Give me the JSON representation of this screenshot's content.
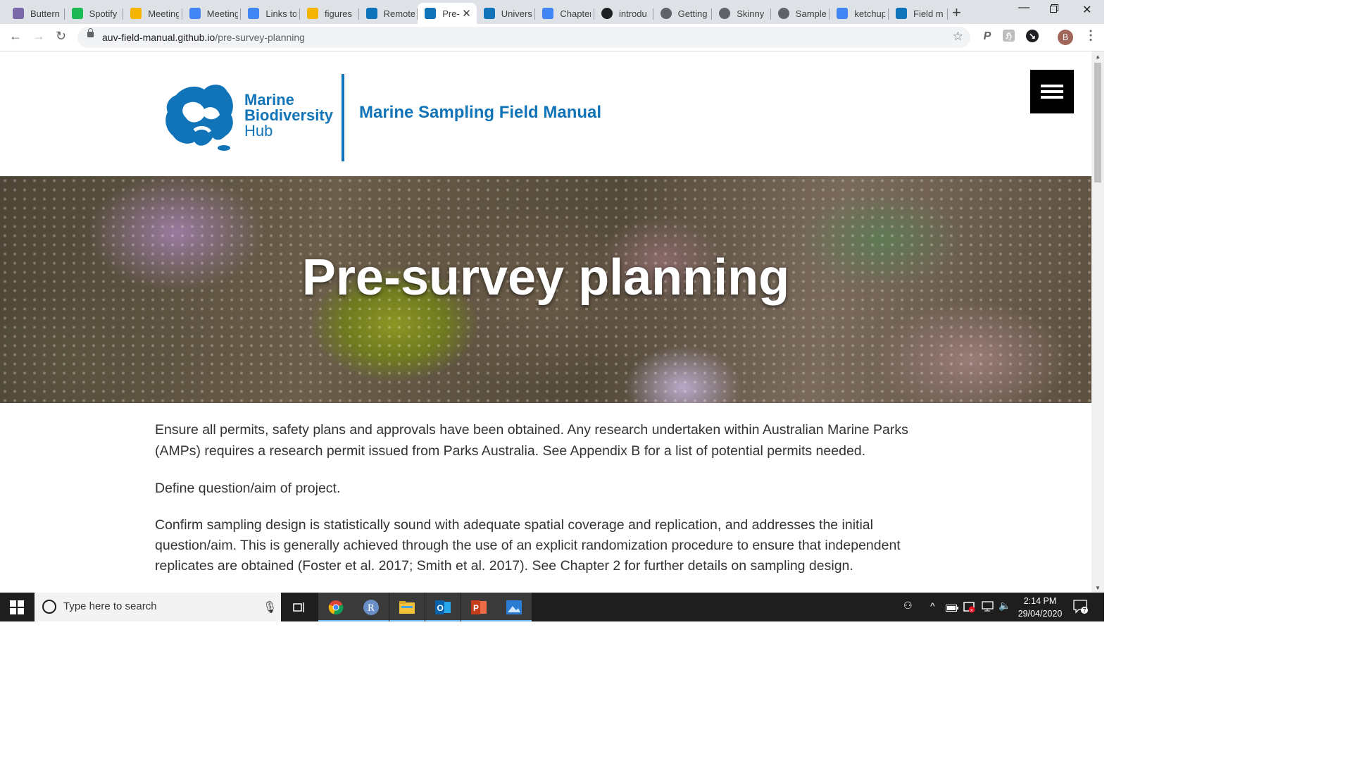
{
  "browser": {
    "tabs": [
      {
        "label": "Buttern",
        "icon": "mr-icon",
        "color": "#7b68a8"
      },
      {
        "label": "Spotify",
        "icon": "spotify-icon",
        "color": "#1db954"
      },
      {
        "label": "Meeting",
        "icon": "drive-icon",
        "color": "#f4b400"
      },
      {
        "label": "Meeting",
        "icon": "docs-icon",
        "color": "#4285f4"
      },
      {
        "label": "Links to",
        "icon": "docs-icon",
        "color": "#4285f4"
      },
      {
        "label": "figures",
        "icon": "drive-icon",
        "color": "#f4b400"
      },
      {
        "label": "Remote",
        "icon": "hub-icon",
        "color": "#1274b8"
      },
      {
        "label": "Pre-",
        "icon": "hub-icon",
        "color": "#1274b8"
      },
      {
        "label": "Univers",
        "icon": "hub-icon",
        "color": "#1274b8"
      },
      {
        "label": "Chapter",
        "icon": "docs-icon",
        "color": "#4285f4"
      },
      {
        "label": "introdu",
        "icon": "github-icon",
        "color": "#202124"
      },
      {
        "label": "Getting",
        "icon": "globe-icon",
        "color": "#5f6368"
      },
      {
        "label": "Skinny",
        "icon": "globe-icon",
        "color": "#5f6368"
      },
      {
        "label": "Sample",
        "icon": "globe-icon",
        "color": "#5f6368"
      },
      {
        "label": "ketchup",
        "icon": "google-icon",
        "color": "#4285f4"
      },
      {
        "label": "Field m",
        "icon": "hub-icon",
        "color": "#1274b8"
      }
    ],
    "active_tab_index": 7,
    "url_host": "auv-field-manual.github.io",
    "url_path": "/pre-survey-planning",
    "profile_initial": "B"
  },
  "site": {
    "logo_line1": "Marine",
    "logo_line2": "Biodiversity",
    "logo_line3": "Hub",
    "title": "Marine Sampling Field Manual",
    "brand_color": "#1274b8"
  },
  "hero": {
    "heading": "Pre-survey planning"
  },
  "content": {
    "p1": "Ensure all permits, safety plans and approvals have been obtained. Any research undertaken within Australian Marine Parks (AMPs) requires a research permit issued from Parks Australia. See Appendix B for a list of potential permits needed.",
    "p2": "Define question/aim of project.",
    "p3": "Confirm sampling design is statistically sound with adequate spatial coverage and replication, and addresses the initial question/aim. This is generally achieved through the use of an explicit randomization procedure to ensure that independent replicates are obtained (Foster et al. 2017; Smith et al. 2017). See Chapter 2 for further details on sampling design."
  },
  "taskbar": {
    "search_placeholder": "Type here to search",
    "time": "2:14 PM",
    "date": "29/04/2020",
    "notification_count": "7",
    "apps": [
      "chrome-icon",
      "r-icon",
      "file-explorer-icon",
      "outlook-icon",
      "powerpoint-icon",
      "photos-icon"
    ]
  }
}
